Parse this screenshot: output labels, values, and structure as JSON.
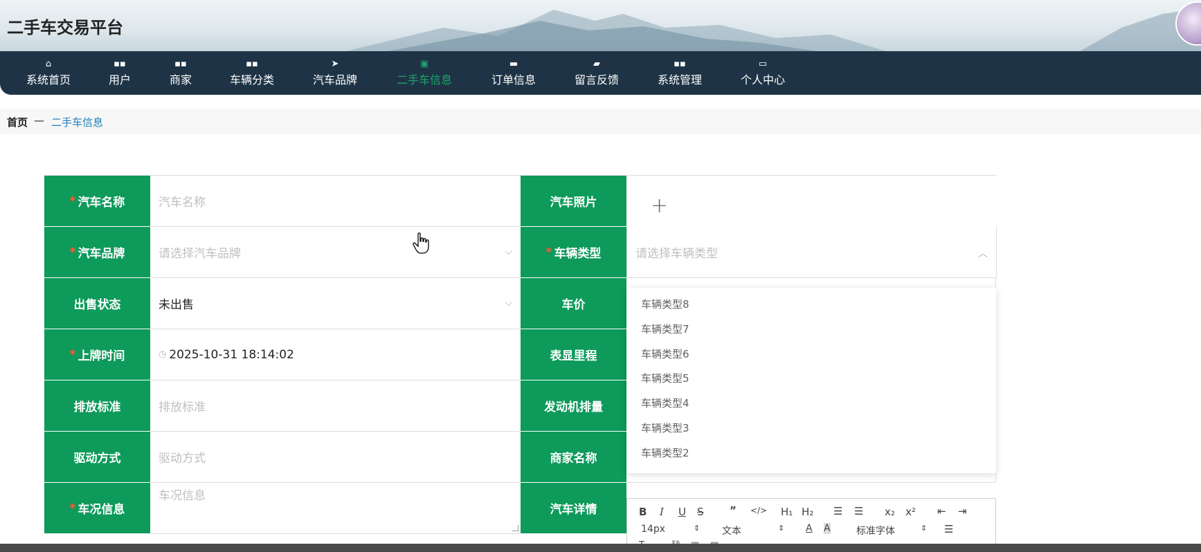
{
  "header": {
    "title": "二手车交易平台"
  },
  "nav": [
    {
      "icon": "home-icon",
      "glyph": "⌂",
      "label": "系统首页",
      "active": false
    },
    {
      "icon": "grid-icon",
      "glyph": "▪▪",
      "label": "用户",
      "active": false
    },
    {
      "icon": "grid-icon",
      "glyph": "▪▪",
      "label": "商家",
      "active": false
    },
    {
      "icon": "grid-icon",
      "glyph": "▪▪",
      "label": "车辆分类",
      "active": false
    },
    {
      "icon": "send-icon",
      "glyph": "➤",
      "label": "汽车品牌",
      "active": false
    },
    {
      "icon": "clipboard-icon",
      "glyph": "▣",
      "label": "二手车信息",
      "active": true
    },
    {
      "icon": "message-icon",
      "glyph": "▬",
      "label": "订单信息",
      "active": false
    },
    {
      "icon": "briefcase-icon",
      "glyph": "▰",
      "label": "留言反馈",
      "active": false
    },
    {
      "icon": "grid-icon",
      "glyph": "▪▪",
      "label": "系统管理",
      "active": false
    },
    {
      "icon": "card-icon",
      "glyph": "▭",
      "label": "个人中心",
      "active": false
    }
  ],
  "breadcrumb": {
    "home": "首页",
    "separator": "—",
    "current": "二手车信息"
  },
  "form": {
    "car_name": {
      "label": "汽车名称",
      "placeholder": "汽车名称"
    },
    "car_brand": {
      "label": "汽车品牌",
      "placeholder": "请选择汽车品牌"
    },
    "sale_status": {
      "label": "出售状态",
      "value": "未出售"
    },
    "plate_time": {
      "label": "上牌时间",
      "value": "2025-10-31 18:14:02"
    },
    "emission": {
      "label": "排放标准",
      "placeholder": "排放标准"
    },
    "drive": {
      "label": "驱动方式",
      "placeholder": "驱动方式"
    },
    "condition": {
      "label": "车况信息",
      "placeholder": "车况信息"
    },
    "photo": {
      "label": "汽车照片",
      "add": "+"
    },
    "vehicle_type": {
      "label": "车辆类型",
      "placeholder": "请选择车辆类型"
    },
    "price": {
      "label": "车价"
    },
    "mileage": {
      "label": "表显里程"
    },
    "displacement": {
      "label": "发动机排量"
    },
    "merchant": {
      "label": "商家名称"
    },
    "details": {
      "label": "汽车详情"
    }
  },
  "required_mark": "*",
  "vehicle_type_options": [
    "车辆类型8",
    "车辆类型7",
    "车辆类型6",
    "车辆类型5",
    "车辆类型4",
    "车辆类型3",
    "车辆类型2"
  ],
  "editor_toolbar": {
    "font_size": "14px",
    "block_format": "文本",
    "font_family": "标准字体"
  },
  "colors": {
    "nav_bg": "#1e3446",
    "label_bg": "#0d9a5a",
    "active_nav": "#1aa866",
    "required": "#ff5a36"
  }
}
